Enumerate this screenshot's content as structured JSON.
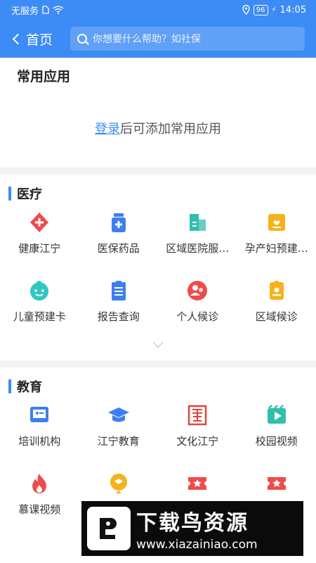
{
  "status": {
    "carrier": "无服务",
    "battery": "96",
    "time": "14:05"
  },
  "nav": {
    "back_label": "首页",
    "search_placeholder": "你想要什么帮助？如社保"
  },
  "common": {
    "title": "常用应用",
    "login_link": "登录",
    "hint_rest": "后可添加常用应用"
  },
  "medical": {
    "title": "医疗",
    "items": [
      {
        "label": "健康江宁",
        "icon": "health-cross-icon",
        "color": "#ef4b4b"
      },
      {
        "label": "医保药品",
        "icon": "medicine-bottle-icon",
        "color": "#3d7ff2"
      },
      {
        "label": "区域医院服…",
        "icon": "hospital-building-icon",
        "color": "#30bfae"
      },
      {
        "label": "孕产妇预建…",
        "icon": "maternity-card-icon",
        "color": "#f6b21c"
      },
      {
        "label": "儿童预建卡",
        "icon": "child-face-icon",
        "color": "#2fc7c0"
      },
      {
        "label": "报告查询",
        "icon": "report-clipboard-icon",
        "color": "#3d7ff2"
      },
      {
        "label": "个人候诊",
        "icon": "person-wait-icon",
        "color": "#ef4b4b"
      },
      {
        "label": "区域候诊",
        "icon": "id-badge-icon",
        "color": "#f6b21c"
      }
    ]
  },
  "education": {
    "title": "教育",
    "items": [
      {
        "label": "培训机构",
        "icon": "training-board-icon",
        "color": "#3d7ff2"
      },
      {
        "label": "江宁教育",
        "icon": "graduation-cap-icon",
        "color": "#3d7ff2"
      },
      {
        "label": "文化江宁",
        "icon": "culture-seal-icon",
        "color": "#e0453a"
      },
      {
        "label": "校园视频",
        "icon": "video-play-icon",
        "color": "#30bfae"
      },
      {
        "label": "慕课视频",
        "icon": "flame-icon",
        "color": "#ef4b4b"
      },
      {
        "label": "",
        "icon": "yellow-badge-icon",
        "color": "#f6b21c"
      },
      {
        "label": "",
        "icon": "ticket-star-icon",
        "color": "#ef4b4b"
      },
      {
        "label": "",
        "icon": "ticket-star-icon",
        "color": "#ef4b4b"
      }
    ]
  },
  "watermark": {
    "brand": "下载鸟资源",
    "url": "www.xiazainiao.com"
  }
}
